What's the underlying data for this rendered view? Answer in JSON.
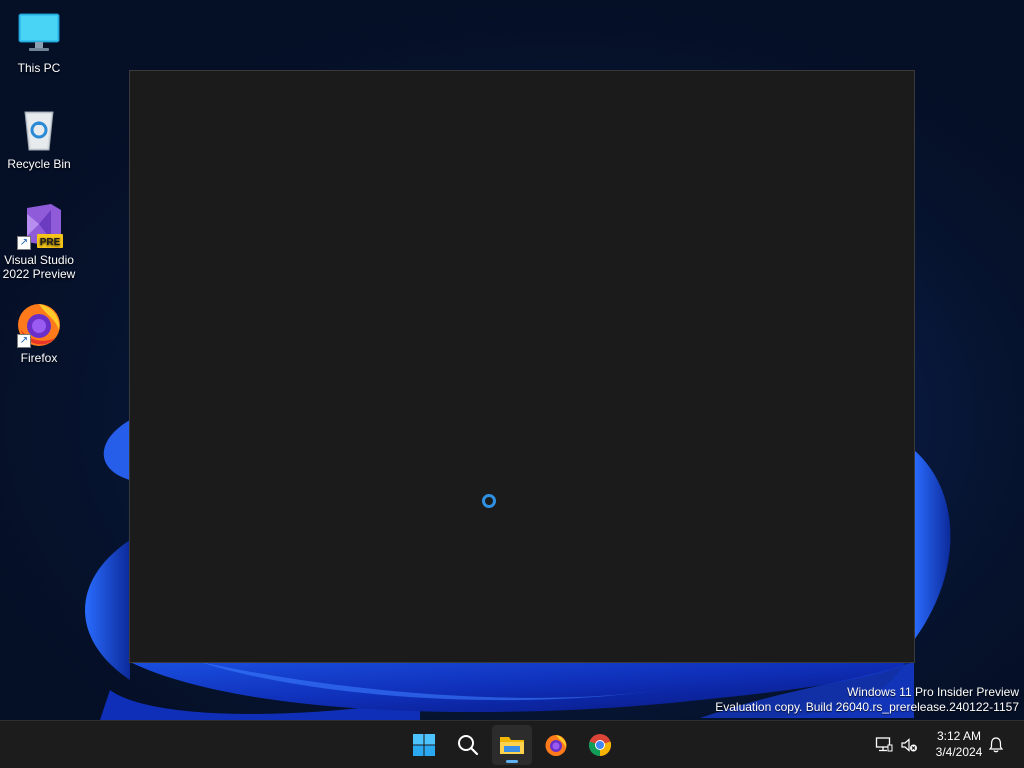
{
  "desktop": {
    "icons": [
      {
        "label": "This PC"
      },
      {
        "label": "Recycle Bin"
      },
      {
        "label_line1": "Visual Studio",
        "label_line2": "2022 Preview",
        "badge": "PRE"
      },
      {
        "label": "Firefox"
      }
    ]
  },
  "watermark": {
    "line1": "Windows 11 Pro Insider Preview",
    "line2": "Evaluation copy. Build 26040.rs_prerelease.240122-1157"
  },
  "taskbar": {
    "apps": [
      {
        "icon": "windows-start-icon"
      },
      {
        "icon": "search-icon"
      },
      {
        "icon": "file-explorer-icon"
      },
      {
        "icon": "firefox-icon"
      },
      {
        "icon": "chrome-icon"
      }
    ],
    "tray": {
      "time": "3:12 AM",
      "date": "3/4/2024"
    }
  },
  "colors": {
    "accent": "#2f8fe3",
    "window_bg": "#1b1b1b",
    "taskbar_bg": "#1c1c1c"
  }
}
